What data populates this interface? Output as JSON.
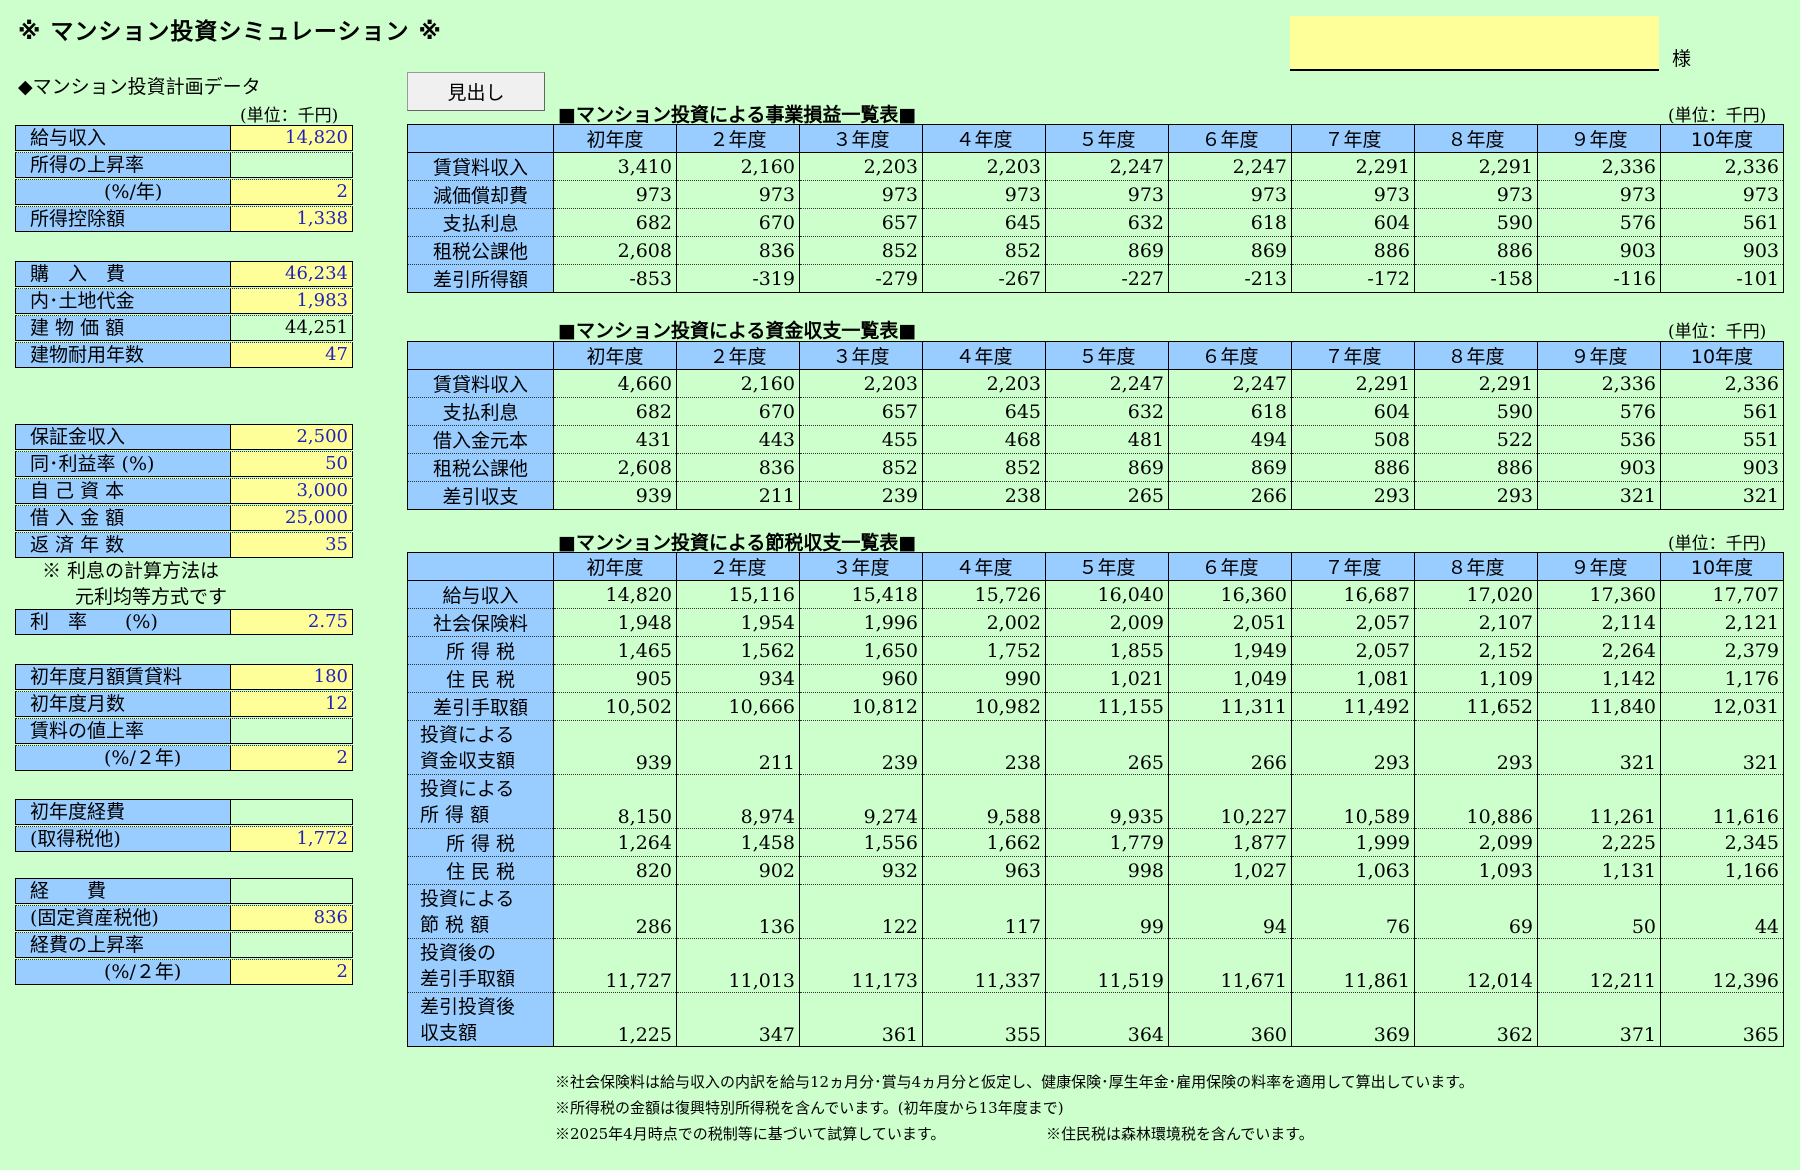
{
  "title": "※ マンション投資シミュレーション ※",
  "customer_suffix": "様",
  "left": {
    "heading": "◆マンション投資計画データ",
    "unit": "(単位：千円)",
    "group1": [
      {
        "label": "給与収入",
        "value": "14,820"
      },
      {
        "label": "所得の上昇率",
        "value": ""
      },
      {
        "label": "(%/年)",
        "value": "2"
      },
      {
        "label": "所得控除額",
        "value": "1,338"
      }
    ],
    "group2": [
      {
        "label": "購　入　費",
        "value": "46,234"
      },
      {
        "label": "内･土地代金",
        "value": "1,983"
      },
      {
        "label": "建 物 価 額",
        "value": "44,251"
      },
      {
        "label": "建物耐用年数",
        "value": "47"
      }
    ],
    "group3": [
      {
        "label": "保証金収入",
        "value": "2,500"
      },
      {
        "label": "同･利益率 (%)",
        "value": "50"
      },
      {
        "label": "自 己 資 本",
        "value": "3,000"
      },
      {
        "label": "借 入 金 額",
        "value": "25,000"
      },
      {
        "label": "返 済 年 数",
        "value": "35"
      }
    ],
    "note_line1": "※ 利息の計算方法は",
    "note_line2": "元利均等方式です",
    "rate": {
      "label": "利　率　　(%)",
      "value": "2.75"
    },
    "group4": [
      {
        "label": "初年度月額賃貸料",
        "value": "180"
      },
      {
        "label": "初年度月数",
        "value": "12"
      },
      {
        "label": "賃料の値上率",
        "value": ""
      },
      {
        "label": "(%/２年)",
        "value": "2"
      }
    ],
    "group5": [
      {
        "label": "初年度経費",
        "value": ""
      },
      {
        "label": "(取得税他)",
        "value": "1,772"
      }
    ],
    "group6": [
      {
        "label": "経　　費",
        "value": ""
      },
      {
        "label": "(固定資産税他)",
        "value": "836"
      },
      {
        "label": "経費の上昇率",
        "value": ""
      },
      {
        "label": "(%/２年)",
        "value": "2"
      }
    ]
  },
  "heading_button": "見出し",
  "unit_label": "(単位：千円)",
  "years": [
    "初年度",
    "２年度",
    "３年度",
    "４年度",
    "５年度",
    "６年度",
    "７年度",
    "８年度",
    "９年度",
    "10年度"
  ],
  "table1": {
    "title": "■マンション投資による事業損益一覧表■",
    "rows": [
      {
        "label": "賃貸料収入",
        "values": [
          "3,410",
          "2,160",
          "2,203",
          "2,203",
          "2,247",
          "2,247",
          "2,291",
          "2,291",
          "2,336",
          "2,336"
        ]
      },
      {
        "label": "減価償却費",
        "values": [
          "973",
          "973",
          "973",
          "973",
          "973",
          "973",
          "973",
          "973",
          "973",
          "973"
        ]
      },
      {
        "label": "支払利息",
        "values": [
          "682",
          "670",
          "657",
          "645",
          "632",
          "618",
          "604",
          "590",
          "576",
          "561"
        ]
      },
      {
        "label": "租税公課他",
        "values": [
          "2,608",
          "836",
          "852",
          "852",
          "869",
          "869",
          "886",
          "886",
          "903",
          "903"
        ]
      },
      {
        "label": "差引所得額",
        "values": [
          "-853",
          "-319",
          "-279",
          "-267",
          "-227",
          "-213",
          "-172",
          "-158",
          "-116",
          "-101"
        ]
      }
    ]
  },
  "table2": {
    "title": "■マンション投資による資金収支一覧表■",
    "rows": [
      {
        "label": "賃貸料収入",
        "values": [
          "4,660",
          "2,160",
          "2,203",
          "2,203",
          "2,247",
          "2,247",
          "2,291",
          "2,291",
          "2,336",
          "2,336"
        ]
      },
      {
        "label": "支払利息",
        "values": [
          "682",
          "670",
          "657",
          "645",
          "632",
          "618",
          "604",
          "590",
          "576",
          "561"
        ]
      },
      {
        "label": "借入金元本",
        "values": [
          "431",
          "443",
          "455",
          "468",
          "481",
          "494",
          "508",
          "522",
          "536",
          "551"
        ]
      },
      {
        "label": "租税公課他",
        "values": [
          "2,608",
          "836",
          "852",
          "852",
          "869",
          "869",
          "886",
          "886",
          "903",
          "903"
        ]
      },
      {
        "label": "差引収支",
        "values": [
          "939",
          "211",
          "239",
          "238",
          "265",
          "266",
          "293",
          "293",
          "321",
          "321"
        ]
      }
    ]
  },
  "table3": {
    "title": "■マンション投資による節税収支一覧表■",
    "rows": [
      {
        "label": "給与収入",
        "label2": "",
        "values": [
          "14,820",
          "15,116",
          "15,418",
          "15,726",
          "16,040",
          "16,360",
          "16,687",
          "17,020",
          "17,360",
          "17,707"
        ]
      },
      {
        "label": "社会保険料",
        "label2": "",
        "values": [
          "1,948",
          "1,954",
          "1,996",
          "2,002",
          "2,009",
          "2,051",
          "2,057",
          "2,107",
          "2,114",
          "2,121"
        ]
      },
      {
        "label": "所 得 税",
        "label2": "",
        "values": [
          "1,465",
          "1,562",
          "1,650",
          "1,752",
          "1,855",
          "1,949",
          "2,057",
          "2,152",
          "2,264",
          "2,379"
        ]
      },
      {
        "label": "住 民 税",
        "label2": "",
        "values": [
          "905",
          "934",
          "960",
          "990",
          "1,021",
          "1,049",
          "1,081",
          "1,109",
          "1,142",
          "1,176"
        ]
      },
      {
        "label": "差引手取額",
        "label2": "",
        "values": [
          "10,502",
          "10,666",
          "10,812",
          "10,982",
          "11,155",
          "11,311",
          "11,492",
          "11,652",
          "11,840",
          "12,031"
        ]
      },
      {
        "label": "投資による",
        "label2": "資金収支額",
        "values": [
          "939",
          "211",
          "239",
          "238",
          "265",
          "266",
          "293",
          "293",
          "321",
          "321"
        ]
      },
      {
        "label": "投資による",
        "label2": "所 得 額",
        "values": [
          "8,150",
          "8,974",
          "9,274",
          "9,588",
          "9,935",
          "10,227",
          "10,589",
          "10,886",
          "11,261",
          "11,616"
        ]
      },
      {
        "label": "所 得 税",
        "label2": "",
        "values": [
          "1,264",
          "1,458",
          "1,556",
          "1,662",
          "1,779",
          "1,877",
          "1,999",
          "2,099",
          "2,225",
          "2,345"
        ]
      },
      {
        "label": "住 民 税",
        "label2": "",
        "values": [
          "820",
          "902",
          "932",
          "963",
          "998",
          "1,027",
          "1,063",
          "1,093",
          "1,131",
          "1,166"
        ]
      },
      {
        "label": "投資による",
        "label2": "節 税 額",
        "values": [
          "286",
          "136",
          "122",
          "117",
          "99",
          "94",
          "76",
          "69",
          "50",
          "44"
        ]
      },
      {
        "label": "投資後の",
        "label2": "差引手取額",
        "values": [
          "11,727",
          "11,013",
          "11,173",
          "11,337",
          "11,519",
          "11,671",
          "11,861",
          "12,014",
          "12,211",
          "12,396"
        ]
      },
      {
        "label": "差引投資後",
        "label2": "収支額",
        "values": [
          "1,225",
          "347",
          "361",
          "355",
          "364",
          "360",
          "369",
          "362",
          "371",
          "365"
        ]
      }
    ]
  },
  "footnotes": [
    "※社会保険料は給与収入の内訳を給与12ヵ月分･賞与4ヵ月分と仮定し、健康保険･厚生年金･雇用保険の料率を適用して算出しています。",
    "※所得税の金額は復興特別所得税を含んでいます。(初年度から13年度まで)",
    "※2025年4月時点での税制等に基づいて試算しています。",
    "※住民税は森林環境税を含んでいます。"
  ]
}
